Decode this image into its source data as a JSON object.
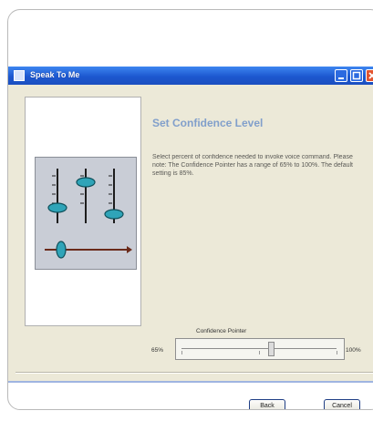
{
  "window": {
    "title": "Speak To Me",
    "controls": {
      "minimize": "minimize-icon",
      "maximize": "maximize-icon",
      "close": "close-icon"
    }
  },
  "wizard": {
    "heading": "Set Confidence Level",
    "description": "Select percent of confidence needed to invoke voice command. Please note: The Confidence Pointer has a range of 65% to 100%. The default setting is 85%.",
    "illustration_icon": "sliders-icon",
    "slider": {
      "label": "Confidence Pointer",
      "min_label": "65%",
      "max_label": "100%",
      "min": 65,
      "max": 100,
      "value": 85
    }
  },
  "buttons": {
    "back": "Back",
    "cancel": "Cancel"
  },
  "colors": {
    "titlebar": "#1c58cf",
    "dialog_bg": "#ece9d8",
    "heading": "#3b6fc3"
  }
}
